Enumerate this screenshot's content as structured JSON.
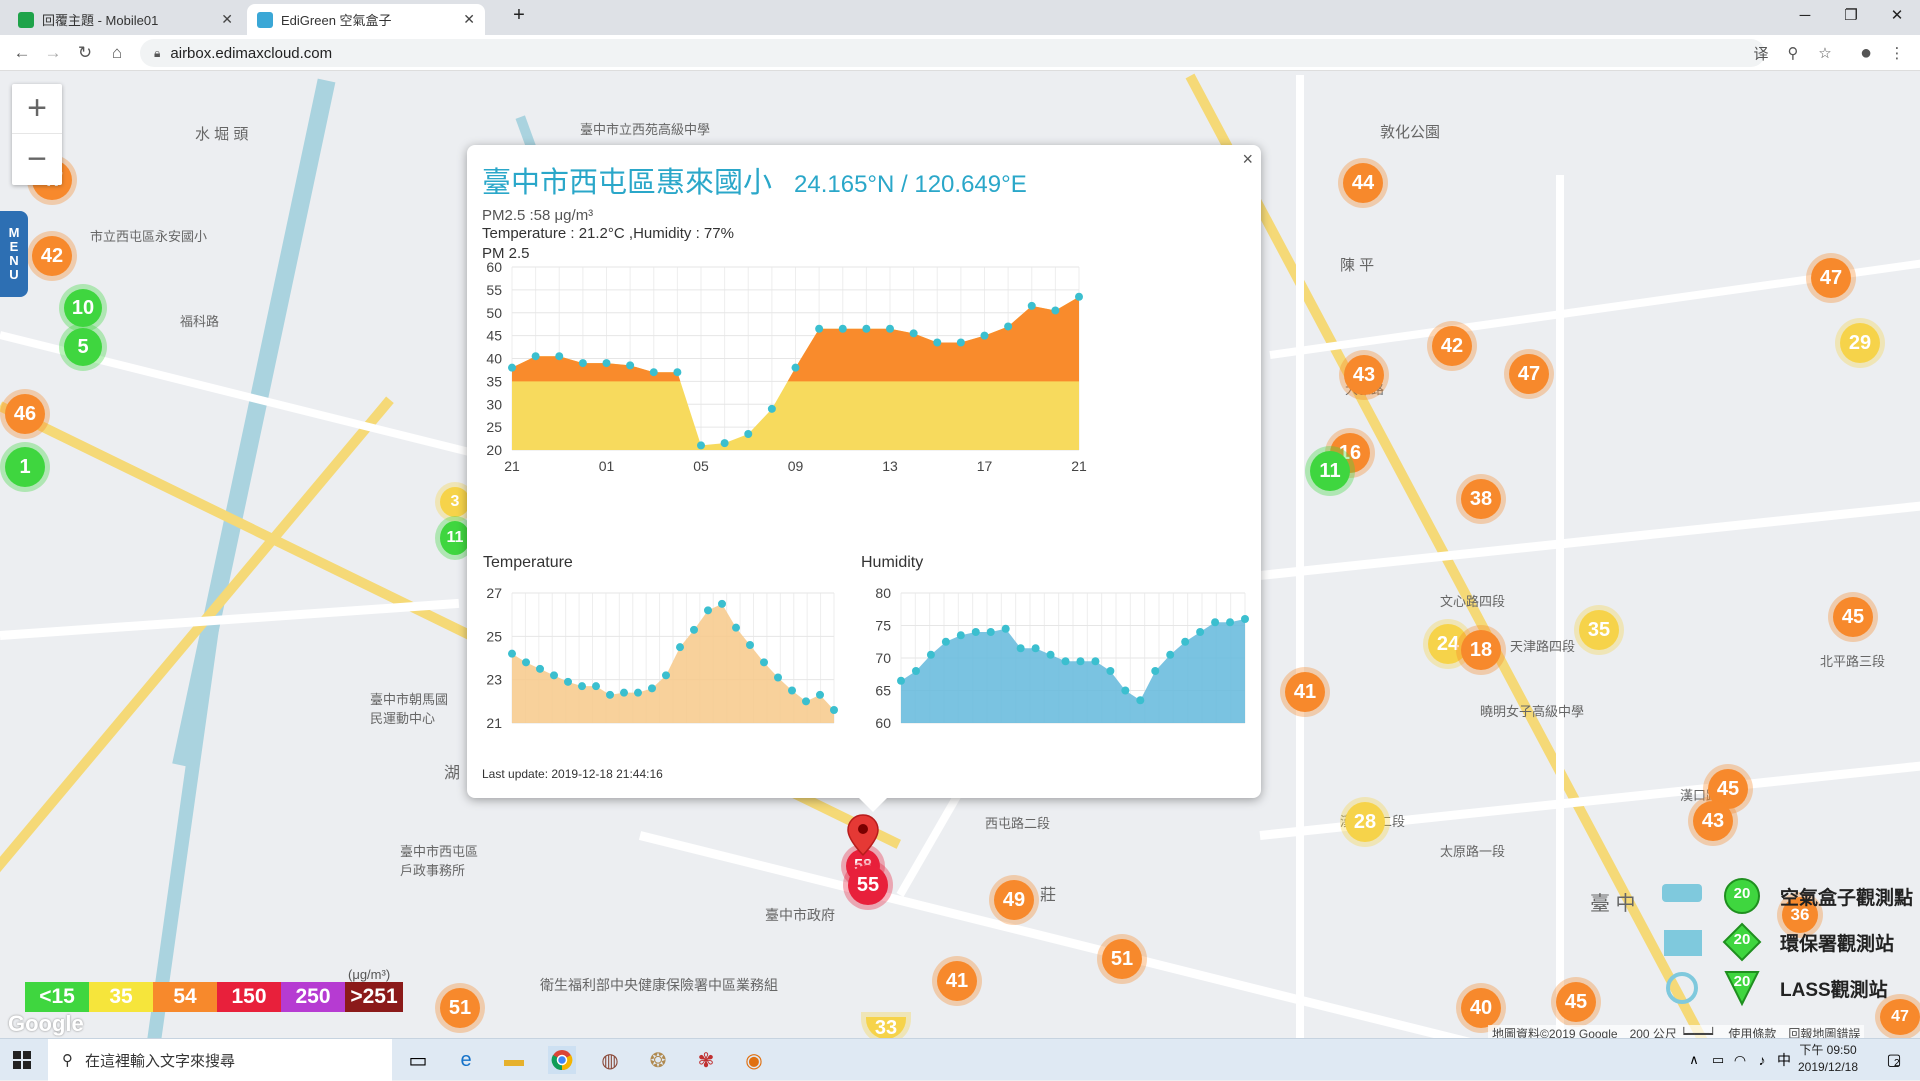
{
  "browser": {
    "tabs": [
      {
        "title": "回覆主題 - Mobile01",
        "fav_color": "#1fa34a",
        "active": false
      },
      {
        "title": "EdiGreen 空氣盒子",
        "fav_color": "#3aa7d6",
        "active": true
      }
    ],
    "new_tab": "+",
    "window_controls": {
      "minimize": "─",
      "maximize": "❐",
      "close": "✕"
    },
    "url": "airbox.edimaxcloud.com",
    "nav": {
      "back": "←",
      "forward": "→",
      "reload": "↻",
      "home": "⌂"
    },
    "toolbar_icons": {
      "translate": "译",
      "zoom": "⚲",
      "bookmark": "☆",
      "profile": "●",
      "menu": "⋮"
    }
  },
  "map": {
    "zoom_in": "+",
    "zoom_out": "−",
    "menu_tab": [
      "M",
      "E",
      "N",
      "U"
    ],
    "labels": [
      {
        "text": "水 堀 頭"
      },
      {
        "text": "市立西屯區永安國小"
      },
      {
        "text": "福科路"
      },
      {
        "text": "臺中市立西苑高級中學"
      },
      {
        "text": "敦化公園"
      },
      {
        "text": "陳 平"
      },
      {
        "text": "大雅路"
      },
      {
        "text": "臺中市朝馬國民運動中心"
      },
      {
        "text": "西屯路二段"
      },
      {
        "text": "漢口路二段"
      },
      {
        "text": "臺中市政府"
      },
      {
        "text": "衛生福利部中央健康保險署中區業務組"
      },
      {
        "text": "文心路四段"
      },
      {
        "text": "臺 中"
      },
      {
        "text": "北平路三段"
      },
      {
        "text": "天津路四段"
      },
      {
        "text": "曉明女子高級中學"
      },
      {
        "text": "漢口路四段"
      },
      {
        "text": "太原路一段"
      },
      {
        "text": "臺中市西屯區戶政事務所"
      },
      {
        "text": "湖"
      },
      {
        "text": "莊"
      }
    ],
    "clusters": [
      {
        "v": "47",
        "c": "o"
      },
      {
        "v": "42",
        "c": "o"
      },
      {
        "v": "10",
        "c": "g"
      },
      {
        "v": "5",
        "c": "g"
      },
      {
        "v": "46",
        "c": "o"
      },
      {
        "v": "1",
        "c": "g"
      },
      {
        "v": "44",
        "c": "o"
      },
      {
        "v": "47",
        "c": "o"
      },
      {
        "v": "29",
        "c": "yl"
      },
      {
        "v": "43",
        "c": "o"
      },
      {
        "v": "42",
        "c": "o"
      },
      {
        "v": "47",
        "c": "o"
      },
      {
        "v": "16",
        "c": "o"
      },
      {
        "v": "11",
        "c": "g"
      },
      {
        "v": "38",
        "c": "o"
      },
      {
        "v": "35",
        "c": "yl"
      },
      {
        "v": "24",
        "c": "yl"
      },
      {
        "v": "18",
        "c": "o"
      },
      {
        "v": "41",
        "c": "o"
      },
      {
        "v": "45",
        "c": "o"
      },
      {
        "v": "45",
        "c": "o"
      },
      {
        "v": "43",
        "c": "o"
      },
      {
        "v": "28",
        "c": "yl"
      },
      {
        "v": "49",
        "c": "o"
      },
      {
        "v": "51",
        "c": "o"
      },
      {
        "v": "41",
        "c": "o"
      },
      {
        "v": "40",
        "c": "o"
      },
      {
        "v": "45",
        "c": "o"
      },
      {
        "v": "51",
        "c": "o"
      },
      {
        "v": "33",
        "c": "yl"
      },
      {
        "v": "58",
        "c": "r"
      },
      {
        "v": "55",
        "c": "r"
      },
      {
        "v": "3",
        "c": "yl"
      },
      {
        "v": "11",
        "c": "g"
      },
      {
        "v": "36",
        "c": "o"
      },
      {
        "v": "47",
        "c": "o"
      }
    ],
    "attribution": "地圖資料©2019 Google　200 公尺 ┕━━━┙　使用條款　回報地圖錯誤",
    "google_logo": "Google"
  },
  "popup": {
    "close": "×",
    "site_name": "臺中市西屯區惠來國小",
    "coords": "24.165°N / 120.649°E",
    "pm_line": "PM2.5 :58 μg/m³",
    "env_line": "Temperature : 21.2°C ,Humidity : 77%",
    "pm_chart_label": "PM 2.5",
    "temp_chart_label": "Temperature",
    "hum_chart_label": "Humidity",
    "last_update": "Last update: 2019-12-18 21:44:16"
  },
  "chart_data": [
    {
      "type": "area",
      "title": "PM 2.5",
      "x": [
        "21",
        "",
        "",
        "",
        "01",
        "",
        "",
        "",
        "05",
        "",
        "",
        "",
        "09",
        "",
        "",
        "",
        "13",
        "",
        "",
        "",
        "17",
        "",
        "",
        "",
        "21"
      ],
      "xticks": [
        "21",
        "01",
        "05",
        "09",
        "13",
        "17",
        "21"
      ],
      "values": [
        38,
        40.5,
        40.5,
        39,
        39,
        38.5,
        37,
        37,
        21,
        21.5,
        23.5,
        29,
        38,
        46.5,
        46.5,
        46.5,
        46.5,
        45.5,
        43.5,
        43.5,
        45,
        47,
        51.5,
        50.5,
        53.5
      ],
      "ylim": [
        20,
        60
      ],
      "yticks": [
        20,
        25,
        30,
        35,
        40,
        45,
        50,
        55,
        60
      ],
      "threshold": 35,
      "colors": {
        "below": "#f7da5d",
        "above": "#f98b2c",
        "point": "#3bbfcf"
      }
    },
    {
      "type": "area",
      "title": "Temperature",
      "values": [
        24.2,
        23.8,
        23.5,
        23.2,
        22.9,
        22.7,
        22.7,
        22.3,
        22.4,
        22.4,
        22.6,
        23.2,
        24.5,
        25.3,
        26.2,
        26.5,
        25.4,
        24.6,
        23.8,
        23.1,
        22.5,
        22.0,
        22.3,
        21.6
      ],
      "ylim": [
        21,
        27
      ],
      "yticks": [
        21,
        23,
        25,
        27
      ],
      "colors": {
        "fill": "#f7c98a",
        "point": "#3bbfcf"
      }
    },
    {
      "type": "area",
      "title": "Humidity",
      "values": [
        66.5,
        68,
        70.5,
        72.5,
        73.5,
        74,
        74,
        74.5,
        71.5,
        71.5,
        70.5,
        69.5,
        69.5,
        69.5,
        68,
        65,
        63.5,
        68,
        70.5,
        72.5,
        74,
        75.5,
        75.5,
        76
      ],
      "ylim": [
        60,
        80
      ],
      "yticks": [
        60,
        65,
        70,
        75,
        80
      ],
      "colors": {
        "fill": "#63b8dc",
        "point": "#3bbfcf"
      }
    }
  ],
  "aqi_legend": {
    "unit": "(μg/m³)",
    "items": [
      {
        "label": "<15",
        "color": "#3fd63f"
      },
      {
        "label": "35",
        "color": "#f6e53b"
      },
      {
        "label": "54",
        "color": "#f7892c"
      },
      {
        "label": "150",
        "color": "#e8203b"
      },
      {
        "label": "250",
        "color": "#b63bd2"
      },
      {
        "label": ">251",
        "color": "#8b1a1a"
      }
    ]
  },
  "map_legend": [
    {
      "label": "空氣盒子觀測點",
      "badge": "20"
    },
    {
      "label": "環保署觀測站",
      "badge": "20"
    },
    {
      "label": "LASS觀測站",
      "badge": "20"
    }
  ],
  "taskbar": {
    "search_placeholder": "在這裡輸入文字來搜尋",
    "time": "下午 09:50",
    "date": "2019/12/18",
    "ime": "中",
    "notification_count": "2"
  }
}
